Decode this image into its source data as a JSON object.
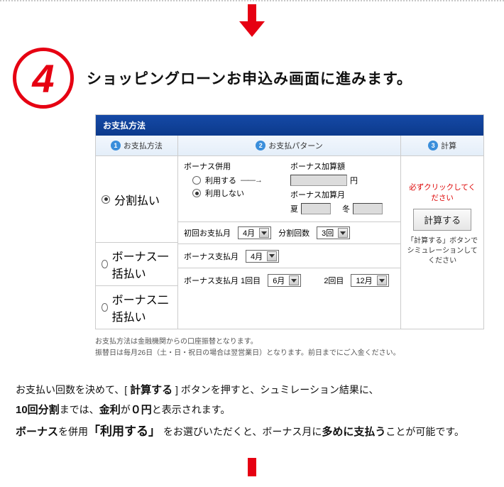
{
  "step": {
    "number": "4",
    "title": "ショッピングローンお申込み画面に進みます。"
  },
  "panel": {
    "header": "お支払方法",
    "cols": {
      "c1": "お支払方法",
      "c2": "お支払パターン",
      "c3": "計算",
      "n1": "1",
      "n2": "2",
      "n3": "3"
    },
    "row1": {
      "option": "分割払い",
      "bonus_title": "ボーナス併用",
      "opt_use": "利用する",
      "opt_notuse": "利用しない",
      "addamt_label": "ボーナス加算額",
      "yen": "円",
      "addmonth_label": "ボーナス加算月",
      "summer": "夏",
      "winter": "冬",
      "first_month_label": "初回お支払月",
      "first_month_value": "4月",
      "split_count_label": "分割回数",
      "split_count_value": "3回"
    },
    "row2": {
      "option": "ボーナス一括払い",
      "bonus_month_label": "ボーナス支払月",
      "bonus_month_value": "4月"
    },
    "row3": {
      "option": "ボーナス二括払い",
      "label": "ボーナス支払月 1回目",
      "value1": "6月",
      "label2": "2回目",
      "value2": "12月"
    },
    "right": {
      "must": "必ずクリックしてください",
      "button": "計算する",
      "note": "「計算する」ボタンでシミュレーションしてください"
    }
  },
  "notes": {
    "n1": "お支払方法は金融機関からの口座振替となります。",
    "n2": "振替日は毎月26日（土・日・祝日の場合は翌営業日）となります。前日までにご入金ください。"
  },
  "desc": {
    "t1a": "お支払い回数を決めて、[ ",
    "t1b": "計算する",
    "t1c": " ] ボタンを押すと、シュミレーション結果に、",
    "t2a": "10回分割",
    "t2b": "までは、",
    "t2c": "金利",
    "t2d": "が",
    "t2e": "０円",
    "t2f": "と表示されます。",
    "t3a": "ボーナス",
    "t3b": "を併用",
    "t3c": "「利用する」",
    "t3d": " をお選びいただくと、ボーナス月に",
    "t3e": "多めに支払う",
    "t3f": "ことが可能です。"
  }
}
